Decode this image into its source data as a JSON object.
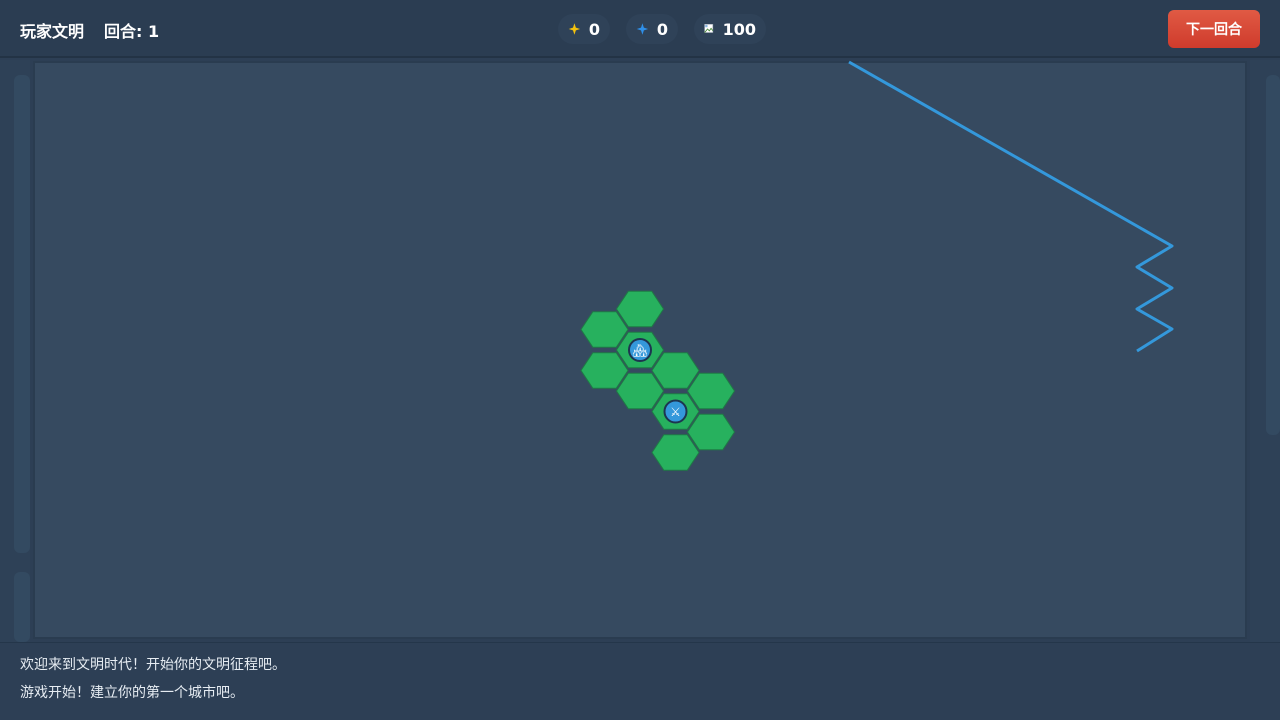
{
  "header": {
    "civ_name": "玩家文明",
    "turn_label": "回合: 1",
    "next_turn_label": "下一回合"
  },
  "resources": {
    "gold": {
      "icon": "gold-star-icon",
      "value": "0",
      "color": "#f4c20d"
    },
    "science": {
      "icon": "science-star-icon",
      "value": "0",
      "color": "#2f8fe8"
    },
    "population": {
      "icon": "broken-image-icon",
      "value": "100"
    }
  },
  "map": {
    "tile_color": "#27b15e",
    "tile_stroke": "#1f7a45",
    "route_color": "#3498db",
    "tiles": [
      {
        "q": 0,
        "r": -2
      },
      {
        "q": -1,
        "r": -1
      },
      {
        "q": 1,
        "r": -1
      },
      {
        "q": 0,
        "r": -1
      },
      {
        "q": 2,
        "r": -1
      },
      {
        "q": -1,
        "r": 0
      },
      {
        "q": 1,
        "r": 0
      },
      {
        "q": 0,
        "r": 0
      },
      {
        "q": 2,
        "r": 0
      },
      {
        "q": 1,
        "r": 1
      }
    ],
    "units": [
      {
        "type": "city",
        "icon": "city-icon",
        "glyph": "🏘",
        "q": 0,
        "r": -1
      },
      {
        "type": "warrior",
        "icon": "crossed-swords-icon",
        "glyph": "⚔",
        "q": 1,
        "r": 0
      }
    ]
  },
  "log": {
    "lines": [
      "欢迎来到文明时代！开始你的文明征程吧。",
      "游戏开始！建立你的第一个城市吧。"
    ]
  },
  "colors": {
    "header_bg": "#2b3d52",
    "map_bg": "#364a60",
    "next_turn": "#d9463a"
  }
}
